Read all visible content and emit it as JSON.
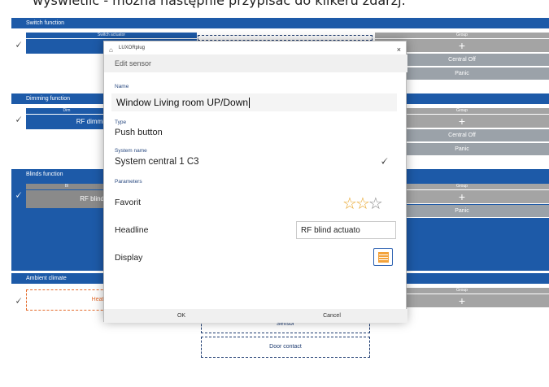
{
  "caption": "wyświetlić - można następnie przypisać do kilkeru zdarzj.",
  "sections": {
    "switch": {
      "title": "Switch function",
      "actuator_header": "Switch actuator",
      "actuator_label": "RF switch",
      "group_arrow": ">",
      "group_header": "Group",
      "group_plus": "+",
      "group_items": [
        "Central Off",
        "Panic"
      ]
    },
    "dimming": {
      "title": "Dimming function",
      "actuator_header": "Dim",
      "actuator_label": "RF dimmi",
      "group_header": "Group",
      "group_plus": "+",
      "group_items": [
        "Central Off",
        "Panic"
      ]
    },
    "blinds": {
      "title": "Blinds function",
      "actuator_header": "Bl",
      "actuator_label": "RF blind",
      "group_header": "Group",
      "group_plus": "+",
      "group_items": [
        "Panic"
      ]
    },
    "ambient": {
      "title": "Ambient climate",
      "actuator_label": "Heati",
      "group_header": "Group",
      "group_plus": "+"
    }
  },
  "sensors": [
    "Sensor",
    "Door contact"
  ],
  "icons": {
    "bulb": "bulb-icon",
    "close": "close-icon",
    "app": "luxorplug-app-icon",
    "star": "star-icon",
    "blinds": "blinds-icon"
  },
  "dialog": {
    "app_title": "LUXORplug",
    "close_glyph": "×",
    "header": "Edit sensor",
    "name_label": "Name",
    "name_value": "Window Living room UP/Down",
    "type_label": "Type",
    "type_value": "Push button",
    "system_name_label": "System name",
    "system_name_value": "System central 1 C3",
    "parameters_label": "Parameters",
    "favorit_label": "Favorit",
    "favorit_rating": 2,
    "favorit_max": 3,
    "headline_label": "Headline",
    "headline_value": "RF blind actuato",
    "display_label": "Display",
    "ok_label": "OK",
    "cancel_label": "Cancel"
  },
  "colors": {
    "accent": "#1d5aa8",
    "star_on": "#e8a52a",
    "blinds_icon": "#f3a23a",
    "warning": "#e46a2a"
  }
}
